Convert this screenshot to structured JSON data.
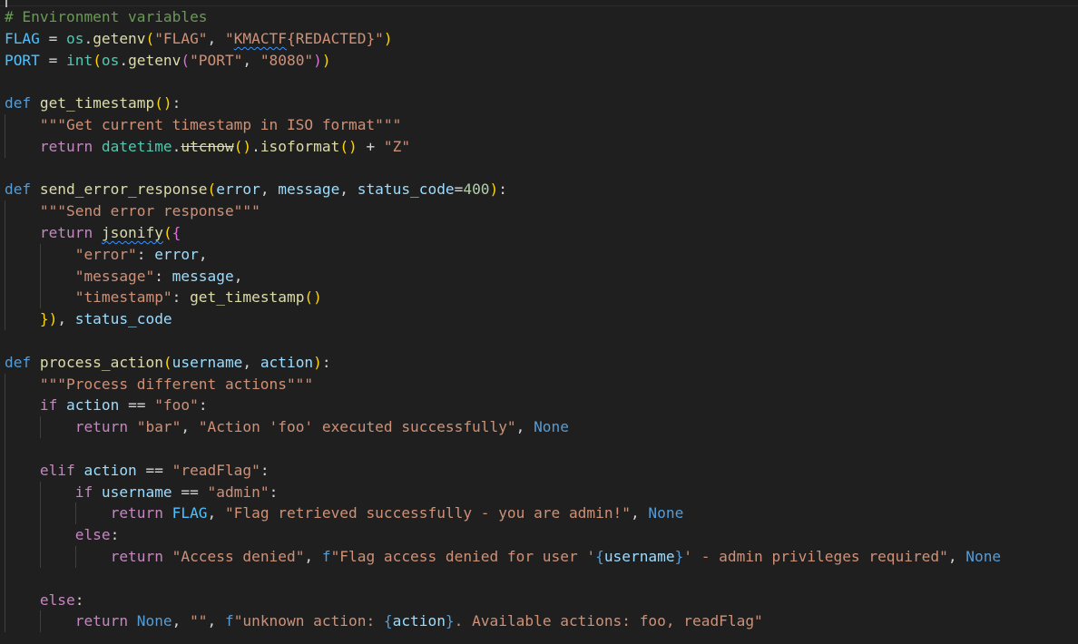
{
  "editor": {
    "language": "python",
    "colors": {
      "background": "#1f1f1f",
      "keyword": "#569cd6",
      "control": "#c586c0",
      "function": "#dcdcaa",
      "variable": "#9cdcfe",
      "module": "#4ec9b0",
      "string": "#ce9178",
      "number": "#b5cea8",
      "comment": "#6a9955"
    },
    "lines": [
      {
        "text": "# Environment variables"
      },
      {
        "text": "FLAG = os.getenv(\"FLAG\", \"KMACTF{REDACTED}\")"
      },
      {
        "text": "PORT = int(os.getenv(\"PORT\", \"8080\"))"
      },
      {
        "text": ""
      },
      {
        "text": "def get_timestamp():"
      },
      {
        "text": "    \"\"\"Get current timestamp in ISO format\"\"\""
      },
      {
        "text": "    return datetime.utcnow().isoformat() + \"Z\""
      },
      {
        "text": ""
      },
      {
        "text": "def send_error_response(error, message, status_code=400):"
      },
      {
        "text": "    \"\"\"Send error response\"\"\""
      },
      {
        "text": "    return jsonify({"
      },
      {
        "text": "        \"error\": error,"
      },
      {
        "text": "        \"message\": message,"
      },
      {
        "text": "        \"timestamp\": get_timestamp()"
      },
      {
        "text": "    }), status_code"
      },
      {
        "text": ""
      },
      {
        "text": "def process_action(username, action):"
      },
      {
        "text": "    \"\"\"Process different actions\"\"\""
      },
      {
        "text": "    if action == \"foo\":"
      },
      {
        "text": "        return \"bar\", \"Action 'foo' executed successfully\", None"
      },
      {
        "text": ""
      },
      {
        "text": "    elif action == \"readFlag\":"
      },
      {
        "text": "        if username == \"admin\":"
      },
      {
        "text": "            return FLAG, \"Flag retrieved successfully - you are admin!\", None"
      },
      {
        "text": "        else:"
      },
      {
        "text": "            return \"Access denied\", f\"Flag access denied for user '{username}' - admin privileges required\", None"
      },
      {
        "text": ""
      },
      {
        "text": "    else:"
      },
      {
        "text": "        return None, \"\", f\"unknown action: {action}. Available actions: foo, readFlag\""
      }
    ]
  }
}
